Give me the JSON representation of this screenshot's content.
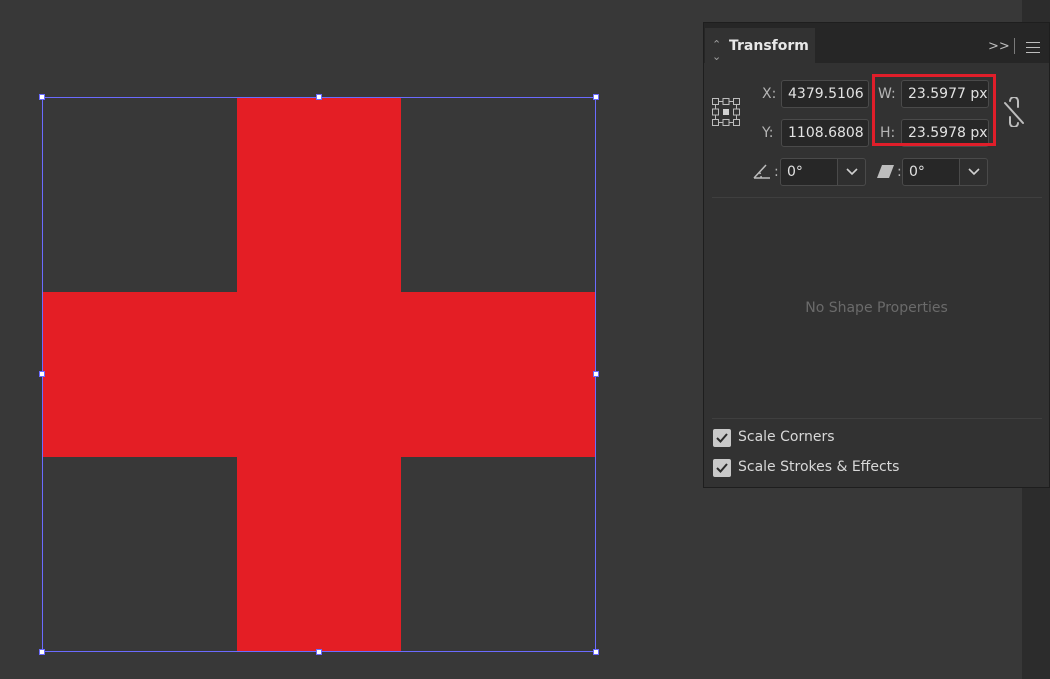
{
  "panel": {
    "title": "Transform",
    "x_label": "X:",
    "x_value": "4379.5106 px",
    "y_label": "Y:",
    "y_value": "1108.6808 px",
    "w_label": "W:",
    "w_value": "23.5977 px",
    "h_label": "H:",
    "h_value": "23.5978 px",
    "rotate_value": "0°",
    "shear_value": "0°",
    "no_shape_text": "No Shape Properties",
    "scale_corners_label": "Scale Corners",
    "scale_corners_checked": true,
    "scale_strokes_label": "Scale Strokes & Effects",
    "scale_strokes_checked": true,
    "collapse_glyph": ">>"
  },
  "colors": {
    "shape_fill": "#e41e25",
    "selection": "#6b6bff",
    "highlight": "#e01e2a",
    "canvas": "#383838",
    "panel": "#323232"
  }
}
